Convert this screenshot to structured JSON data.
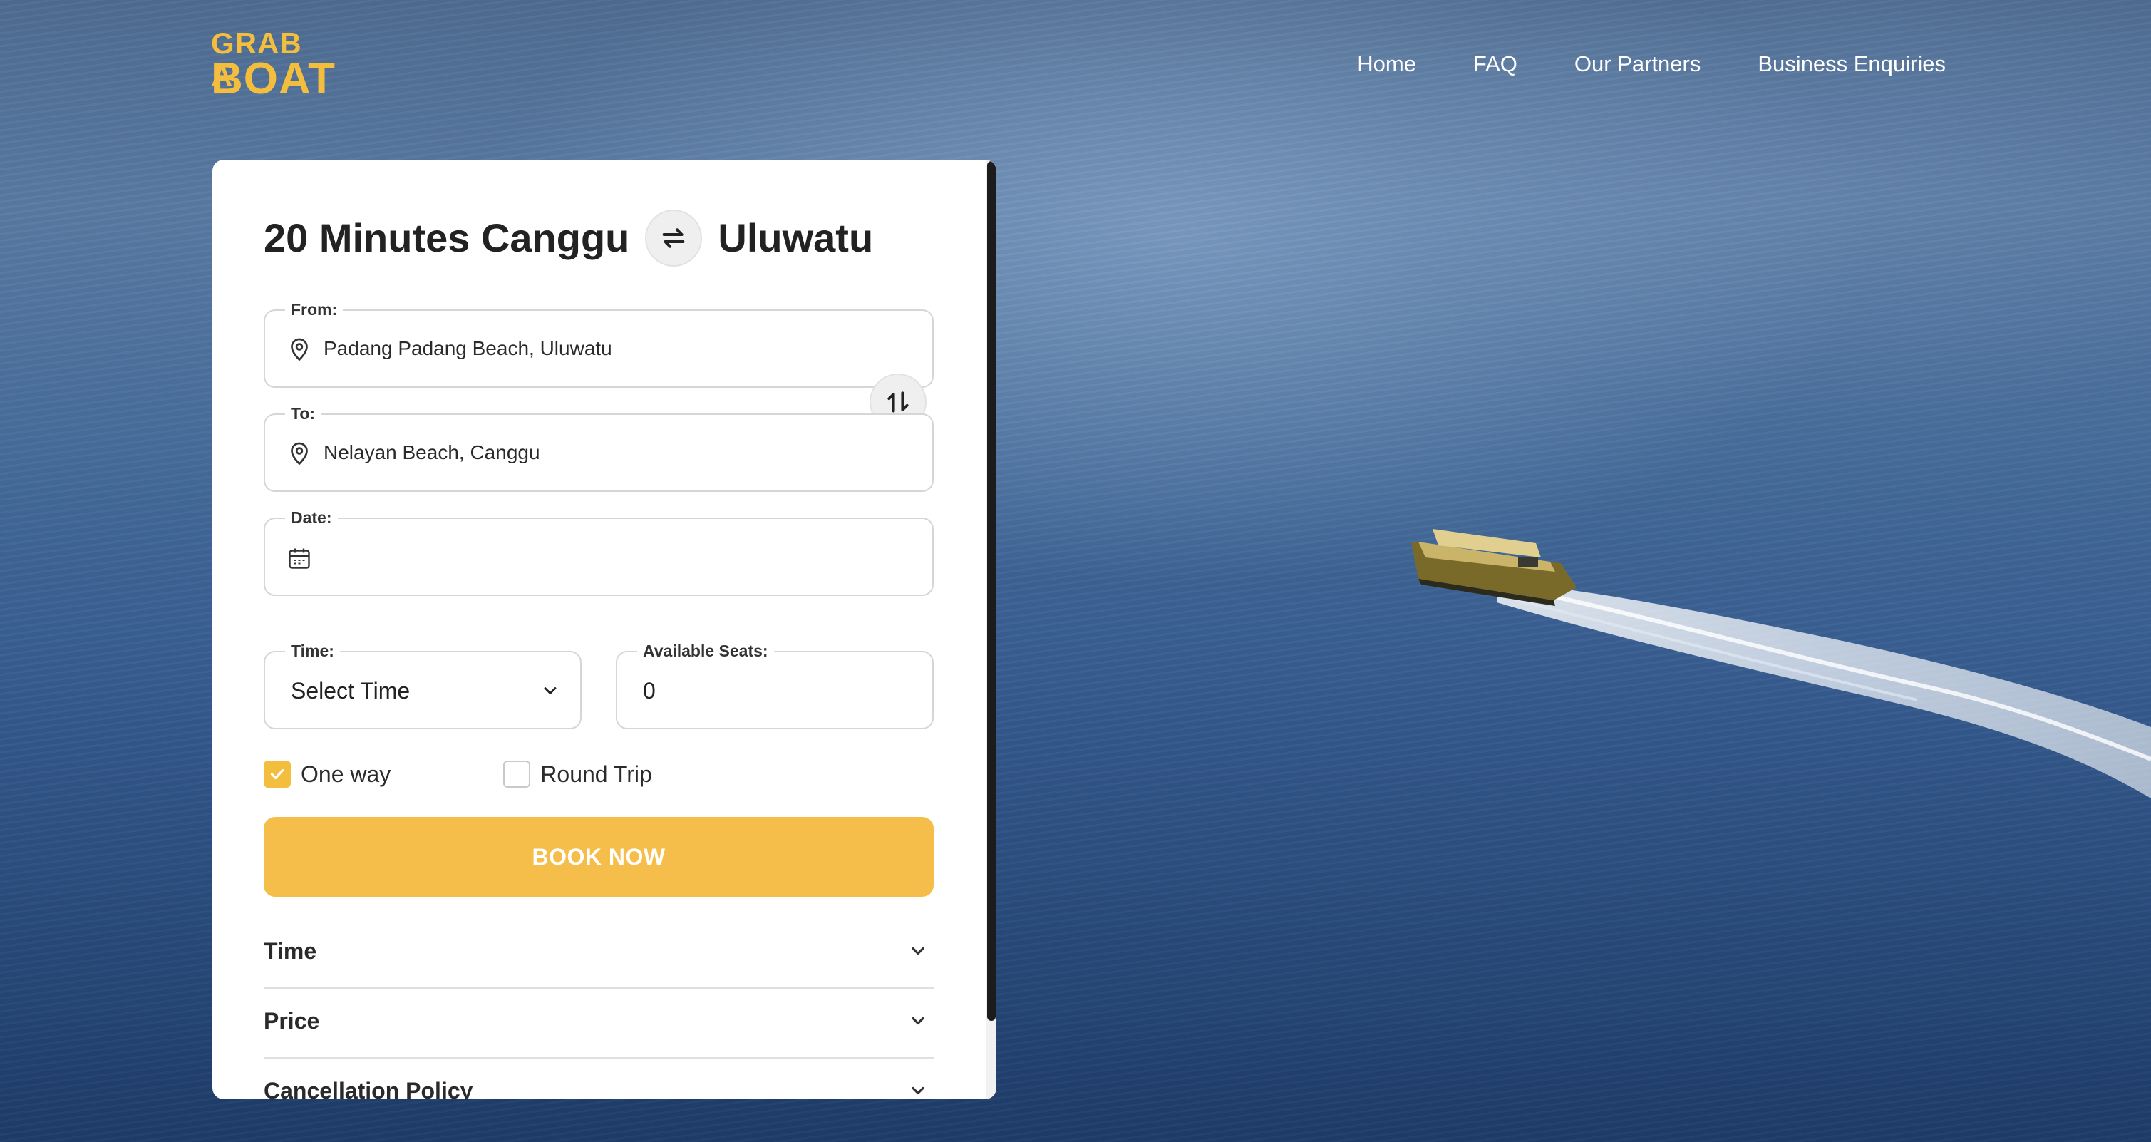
{
  "brand": {
    "logo_line1": "GRAB A",
    "logo_line2": "BOAT",
    "color": "#f3bd3d"
  },
  "nav": {
    "items": [
      {
        "label": "Home"
      },
      {
        "label": "FAQ"
      },
      {
        "label": "Our Partners"
      },
      {
        "label": "Business Enquiries"
      }
    ]
  },
  "booking": {
    "route_duration": "20 Minutes",
    "route_from": "Canggu",
    "route_to": "Uluwatu",
    "from": {
      "label": "From:",
      "value": "Padang Padang Beach, Uluwatu",
      "icon": "map-pin-icon"
    },
    "to": {
      "label": "To:",
      "value": "Nelayan Beach, Canggu",
      "icon": "map-pin-icon"
    },
    "date": {
      "label": "Date:",
      "value": "",
      "icon": "calendar-icon"
    },
    "time": {
      "label": "Time:",
      "value": "Select Time"
    },
    "seats": {
      "label": "Available Seats:",
      "value": "0"
    },
    "trip_type": [
      {
        "label": "One way",
        "checked": true
      },
      {
        "label": "Round Trip",
        "checked": false
      }
    ],
    "book_button": "BOOK NOW",
    "accordion": [
      {
        "title": "Time"
      },
      {
        "title": "Price"
      },
      {
        "title": "Cancellation Policy"
      }
    ],
    "accent_color": "#f5be4a"
  }
}
